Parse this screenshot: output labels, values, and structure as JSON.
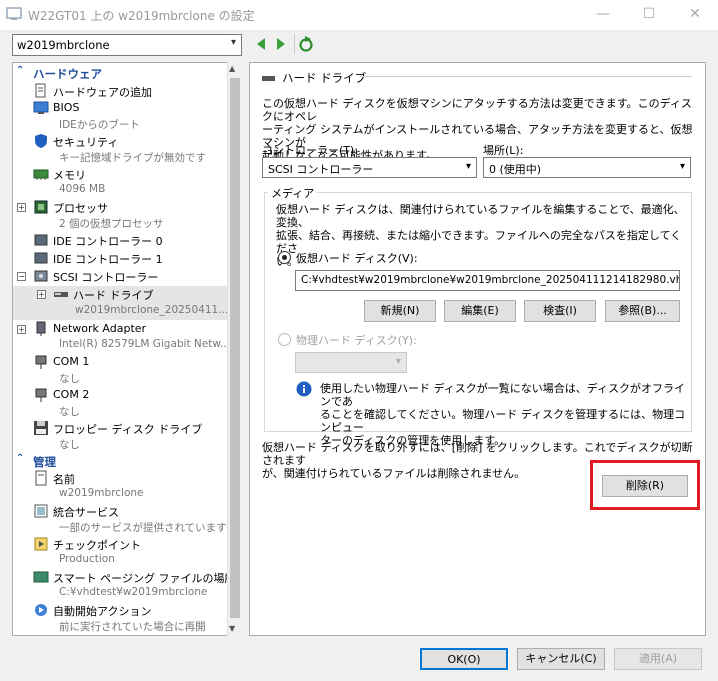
{
  "window": {
    "title": "W22GT01 上の w2019mbrclone の設定",
    "minimize": "—",
    "maximize": "☐",
    "close": "✕"
  },
  "vm_selector": {
    "value": "w2019mbrclone"
  },
  "nav": {
    "back": "◀",
    "forward": "▶",
    "refresh": "↻"
  },
  "tree": {
    "hardware_header": "ハードウェア",
    "management_header": "管理",
    "hardware": [
      {
        "label": "ハードウェアの追加",
        "sub": ""
      },
      {
        "label": "BIOS",
        "sub": "IDEからのブート"
      },
      {
        "label": "セキュリティ",
        "sub": "キー記憶域ドライブが無効です"
      },
      {
        "label": "メモリ",
        "sub": "4096 MB"
      },
      {
        "label": "プロセッサ",
        "sub": "2 個の仮想プロセッサ"
      },
      {
        "label": "IDE コントローラー 0",
        "sub": ""
      },
      {
        "label": "IDE コントローラー 1",
        "sub": ""
      },
      {
        "label": "SCSI コントローラー",
        "sub": ""
      },
      {
        "label": "ハード ドライブ",
        "sub": "w2019mbrclone_20250411..."
      },
      {
        "label": "Network Adapter",
        "sub": "Intel(R) 82579LM Gigabit Netw..."
      },
      {
        "label": "COM 1",
        "sub": "なし"
      },
      {
        "label": "COM 2",
        "sub": "なし"
      },
      {
        "label": "フロッピー ディスク ドライブ",
        "sub": "なし"
      }
    ],
    "management": [
      {
        "label": "名前",
        "sub": "w2019mbrclone"
      },
      {
        "label": "統合サービス",
        "sub": "一部のサービスが提供されています"
      },
      {
        "label": "チェックポイント",
        "sub": "Production"
      },
      {
        "label": "スマート ページング ファイルの場所",
        "sub": "C:¥vhdtest¥w2019mbrclone"
      },
      {
        "label": "自動開始アクション",
        "sub": "前に実行されていた場合に再開"
      }
    ]
  },
  "hdd": {
    "heading": "ハード ドライブ",
    "intro": [
      "この仮想ハード ディスクを仮想マシンにアタッチする方法は変更できます。このディスクにオペレ",
      "ーティング システムがインストールされている場合、アタッチ方法を変更すると、仮想マシンが",
      "起動しなくなる可能性があります。"
    ],
    "controller_label": "コントローラー(T):",
    "controller_value": "SCSI コントローラー",
    "location_label": "場所(L):",
    "location_value": "0 (使用中)",
    "media_label": "メディア",
    "media_desc": [
      "仮想ハード ディスクは、関連付けられているファイルを編集することで、最適化、変換、",
      "拡張、結合、再接続、または縮小できます。ファイルへの完全なパスを指定してくださ",
      "い。"
    ],
    "vhd_label": "仮想ハード ディスク(V):",
    "vhd_path": "C:¥vhdtest¥w2019mbrclone¥w2019mbrclone_20250411121418298​0.vhdx",
    "buttons": {
      "new": "新規(N)",
      "edit": "編集(E)",
      "inspect": "検査(I)",
      "browse": "参照(B)..."
    },
    "physical_label": "物理ハード ディスク(Y):",
    "info_text": [
      "使用したい物理ハード ディスクが一覧にない場合は、ディスクがオフラインであ",
      "ることを確認してください。物理ハード ディスクを管理するには、物理コンピュー",
      "ターのディスクの管理を使用します。"
    ],
    "remove_desc": [
      "仮想ハード ディスクを取り外すには、[削除] をクリックします。これでディスクが切断されます",
      "が、関連付けられているファイルは削除されません。"
    ],
    "remove_button": "削除(R)"
  },
  "footer": {
    "ok": "OK(O)",
    "cancel": "キャンセル(C)",
    "apply": "適用(A)"
  },
  "colors": {
    "highlight": "#e21b23",
    "section": "#1f4e9c",
    "nav_green": "#3aa13a"
  }
}
